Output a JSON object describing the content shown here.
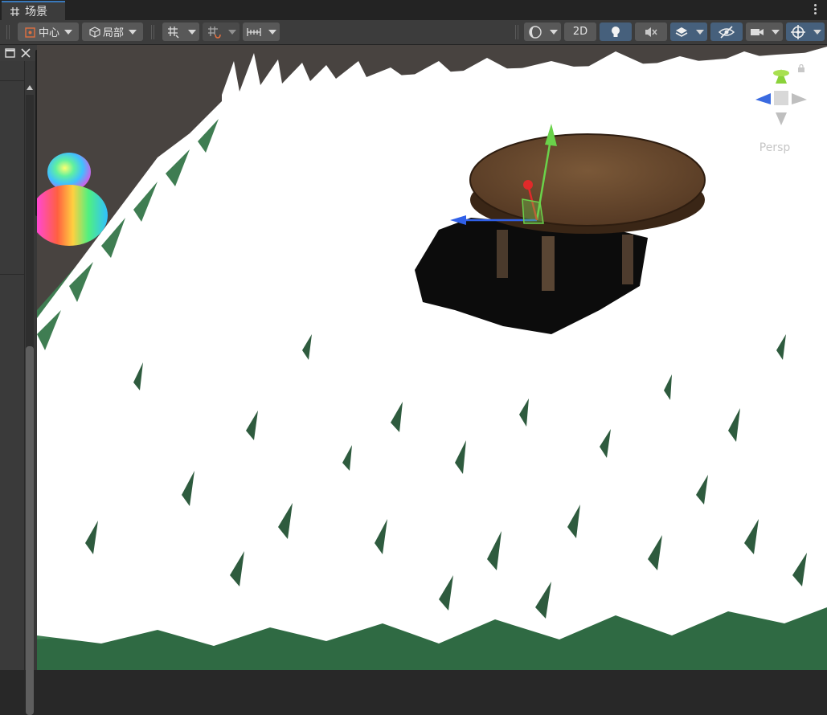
{
  "tab": {
    "label": "场景",
    "icon": "scene-grid-icon"
  },
  "toolbar": {
    "pivot_label": "中心",
    "space_label": "局部",
    "mode_2d_label": "2D",
    "icons": {
      "pivot": "pivot-center-icon",
      "space": "local-space-icon",
      "grid_snap": "grid-snap-icon",
      "increment_snap": "increment-snap-icon",
      "ruler": "ruler-icon",
      "draw_mode": "shading-mode-icon",
      "lighting": "lighting-icon",
      "audio": "audio-mute-icon",
      "effects": "effects-layers-icon",
      "visibility": "scene-visibility-icon",
      "camera": "camera-icon",
      "gizmos": "gizmos-icon"
    }
  },
  "viewport": {
    "projection_label": "Persp",
    "colors": {
      "grass": "#ffffff",
      "ground": "#3f7d52",
      "backdrop": "#484340",
      "table": "#6a4a30"
    }
  },
  "colors": {
    "accent": "#3a79bb",
    "active_button": "#46607c",
    "toolbar": "#3c3c3c"
  }
}
